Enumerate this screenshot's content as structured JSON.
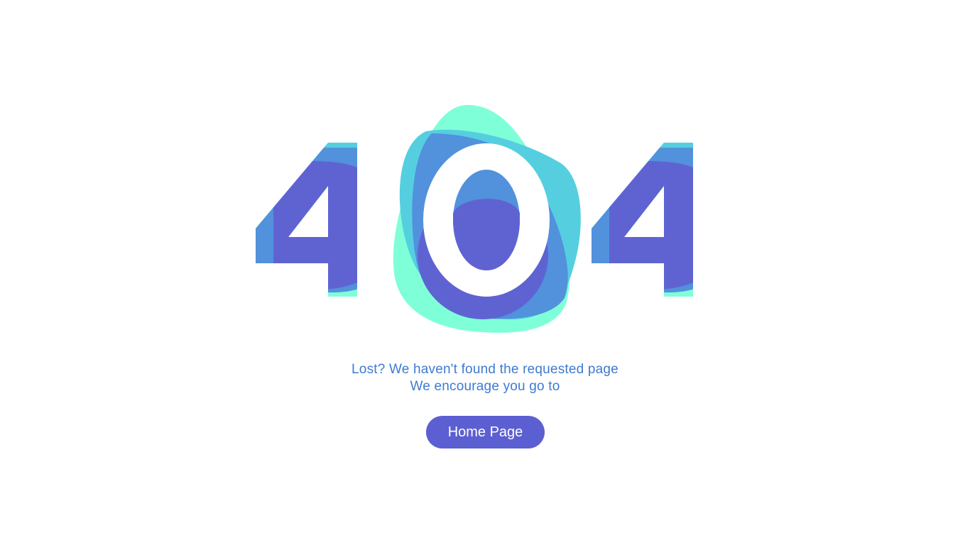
{
  "error": {
    "code_digits": [
      "4",
      "0",
      "4"
    ]
  },
  "message": {
    "line1": "Lost? We haven't found the requested page",
    "line2": "We encourage you go to"
  },
  "actions": {
    "home_label": "Home Page"
  },
  "colors": {
    "text_blue": "#3d7bd1",
    "button_purple": "#5c5fd1",
    "mint": "#7fffd8",
    "cyan": "#55cfe0",
    "blue": "#5291dc",
    "purple": "#5f63d2"
  }
}
